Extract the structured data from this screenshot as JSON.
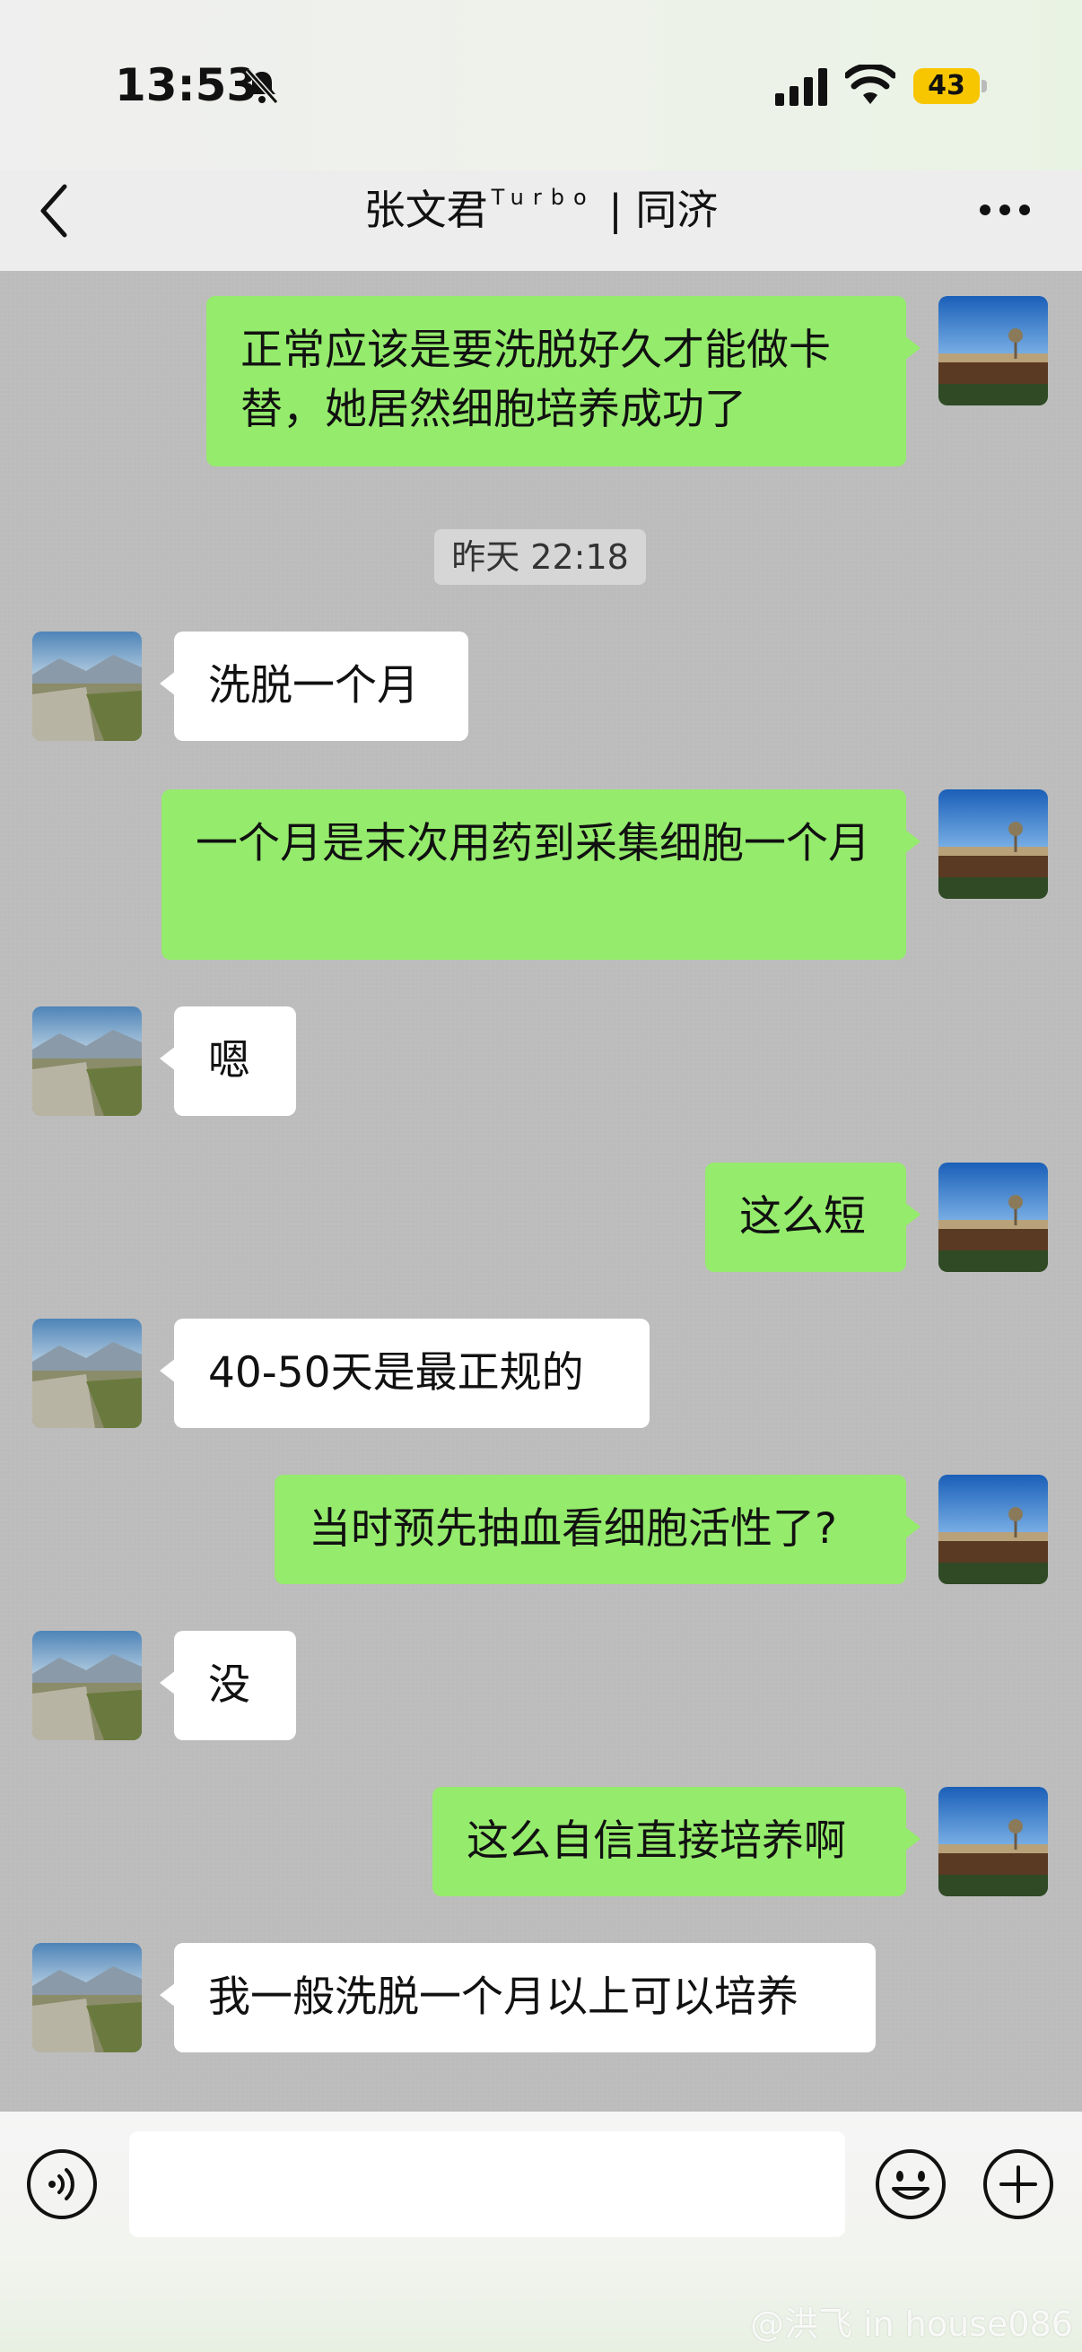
{
  "status_bar": {
    "time": "13:53",
    "battery": "43",
    "icons": [
      "bell-muted-icon",
      "signal-icon",
      "wifi-icon",
      "battery-icon"
    ]
  },
  "header": {
    "title_name": "张文君",
    "title_sup": "Turbo",
    "title_suffix": " | 同济",
    "back_icon": "chevron-left-icon",
    "more_icon": "more-dots-icon"
  },
  "chat": {
    "timestamp": "昨天 22:18",
    "messages": [
      {
        "side": "out",
        "text": "正常应该是要洗脱好久才能做卡替，她居然细胞培养成功了"
      },
      {
        "side": "in",
        "text": "洗脱一个月"
      },
      {
        "side": "out",
        "text": "一个月是末次用药到采集细胞一个月"
      },
      {
        "side": "in",
        "text": "嗯"
      },
      {
        "side": "out",
        "text": "这么短"
      },
      {
        "side": "in",
        "text": "40-50天是最正规的"
      },
      {
        "side": "out",
        "text": "当时预先抽血看细胞活性了?"
      },
      {
        "side": "in",
        "text": "没"
      },
      {
        "side": "out",
        "text": "这么自信直接培养啊"
      },
      {
        "side": "in",
        "text": "我一般洗脱一个月以上可以培养"
      }
    ]
  },
  "input_bar": {
    "placeholder": "",
    "icons": [
      "voice-icon",
      "emoji-icon",
      "plus-icon"
    ]
  },
  "watermark": "@洪飞 in house086",
  "colors": {
    "outgoing_bubble": "#95eb6c",
    "incoming_bubble": "#ffffff",
    "chat_background": "#bcbcbc",
    "battery": "#f7c600"
  }
}
